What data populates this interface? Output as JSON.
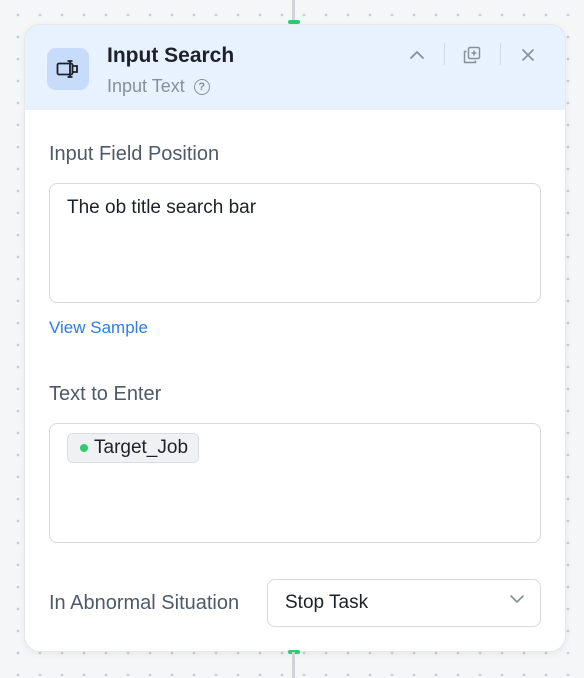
{
  "node": {
    "title": "Input Search",
    "subtitle": "Input Text",
    "icons": {
      "node_type": "text-input-icon",
      "help": "help-circle-icon",
      "collapse": "chevron-up-icon",
      "duplicate": "duplicate-icon",
      "close": "close-icon"
    }
  },
  "fields": {
    "input_position": {
      "label": "Input Field Position",
      "value": "The ob title search bar",
      "link": "View Sample"
    },
    "text_to_enter": {
      "label": "Text to Enter",
      "variable": "Target_Job"
    },
    "abnormal": {
      "label": "In Abnormal Situation",
      "selected": "Stop Task"
    }
  },
  "colors": {
    "header_bg": "#e8f1fe",
    "accent": "#2f7de1",
    "variable_dot": "#2ecc71",
    "connector": "#2ecc71"
  }
}
